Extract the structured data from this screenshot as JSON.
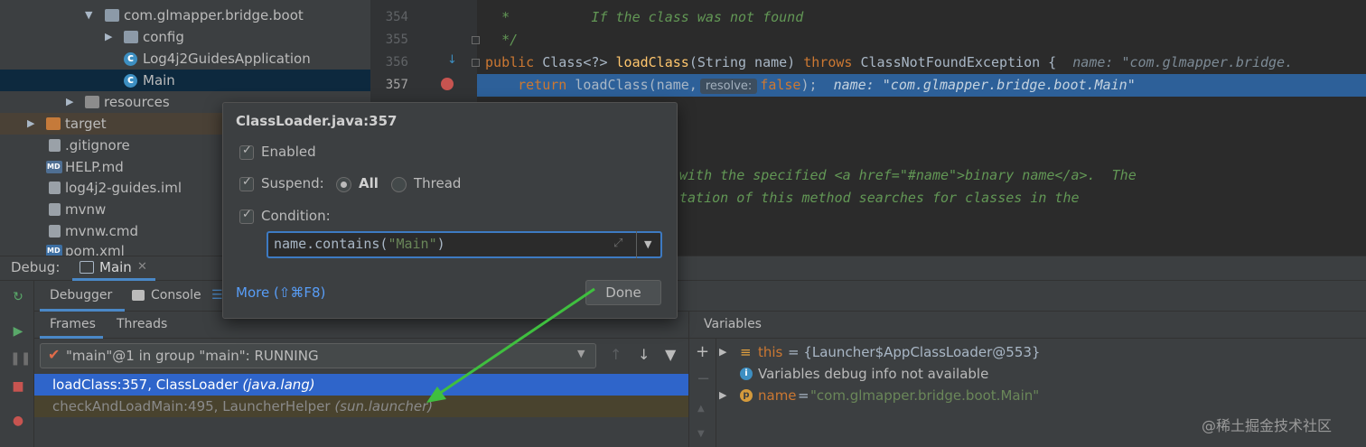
{
  "project_tree": {
    "items": [
      {
        "label": "com.glmapper.bridge.boot",
        "icon": "package-icon"
      },
      {
        "label": "config",
        "icon": "package-icon"
      },
      {
        "label": "Log4j2GuidesApplication",
        "icon": "class-icon"
      },
      {
        "label": "Main",
        "icon": "class-icon"
      },
      {
        "label": "resources",
        "icon": "resources-folder-icon"
      },
      {
        "label": "target",
        "icon": "target-folder-icon"
      },
      {
        "label": ".gitignore",
        "icon": "file-icon"
      },
      {
        "label": "HELP.md",
        "icon": "markdown-icon"
      },
      {
        "label": "log4j2-guides.iml",
        "icon": "file-icon"
      },
      {
        "label": "mvnw",
        "icon": "file-icon"
      },
      {
        "label": "mvnw.cmd",
        "icon": "file-icon"
      },
      {
        "label": "pom.xml",
        "icon": "maven-icon"
      }
    ]
  },
  "editor": {
    "line_numbers": [
      "354",
      "355",
      "356",
      "357"
    ],
    "lines": {
      "l354": "   *          If the class was not found",
      "l355": "   */",
      "l356_kw1": "public",
      "l356_a": " Class<?> ",
      "l356_fn": "loadClass",
      "l356_b": "(String name) ",
      "l356_kw2": "throws",
      "l356_c": " ClassNotFoundException {",
      "l356_hint": "name: \"com.glmapper.bridge.",
      "l357_kw": "return",
      "l357_a": " loadClass(name,",
      "l357_hint_label": "resolve:",
      "l357_kw2": "false",
      "l357_b": ");",
      "l357_hint": "name: \"com.glmapper.bridge.boot.Main\"",
      "l361": "with the specified <a href=\"#name\">binary name</a>.  The",
      "l362": "tation of this method searches for classes in the"
    }
  },
  "breakpoint_popup": {
    "title": "ClassLoader.java:357",
    "enabled_label": "Enabled",
    "suspend_label": "Suspend:",
    "all_label": "All",
    "thread_label": "Thread",
    "condition_label": "Condition:",
    "condition_value_prefix": "name.contains(",
    "condition_value_string": "\"Main\"",
    "condition_value_suffix": ")",
    "more_label": "More (⇧⌘F8)",
    "done_label": "Done",
    "enabled_checked": true,
    "suspend_checked": true,
    "condition_checked": true,
    "suspend_mode": "All"
  },
  "debug": {
    "title_label": "Debug:",
    "session_label": "Main",
    "tabs": {
      "debugger": "Debugger",
      "console": "Console"
    },
    "subtabs": {
      "frames": "Frames",
      "threads": "Threads"
    },
    "thread_combo": "\"main\"@1 in group \"main\": RUNNING",
    "frames": [
      {
        "method": "loadClass:357, ClassLoader",
        "pkg": "(java.lang)"
      },
      {
        "method": "checkAndLoadMain:495, LauncherHelper",
        "pkg": "(sun.launcher)"
      }
    ],
    "variables_header": "Variables",
    "variables": {
      "this_name": "this",
      "this_value": "= {Launcher$AppClassLoader@553}",
      "info": "Variables debug info not available",
      "name_name": "name",
      "name_eq": "=",
      "name_value": "\"com.glmapper.bridge.boot.Main\""
    }
  },
  "watermark": "@稀土掘金技术社区",
  "colors": {
    "accent_blue": "#2f65ca",
    "editor_highlight": "#2d6099",
    "comment_green": "#629755",
    "keyword_orange": "#cc7832",
    "annotation_arrow_green": "#3fbf3f"
  }
}
